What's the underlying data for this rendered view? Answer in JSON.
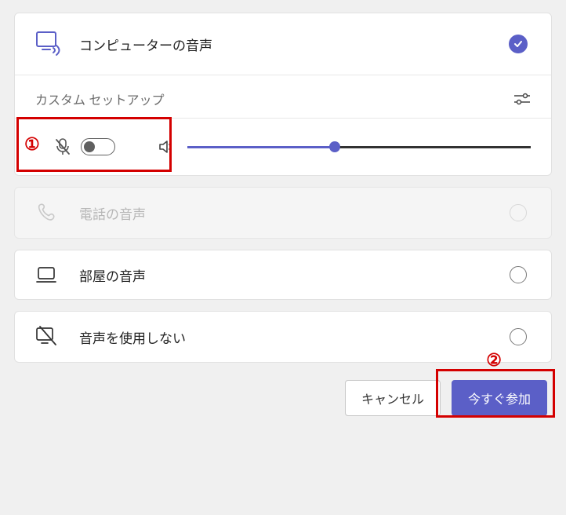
{
  "audio": {
    "computer": {
      "label": "コンピューターの音声",
      "selected": true
    },
    "custom_setup": "カスタム セットアップ",
    "mic_on": false,
    "volume_percent": 43,
    "phone": {
      "label": "電話の音声",
      "enabled": false
    },
    "room": {
      "label": "部屋の音声"
    },
    "none": {
      "label": "音声を使用しない"
    }
  },
  "footer": {
    "cancel": "キャンセル",
    "join": "今すぐ参加"
  },
  "annotations": {
    "n1": "①",
    "n2": "②"
  }
}
